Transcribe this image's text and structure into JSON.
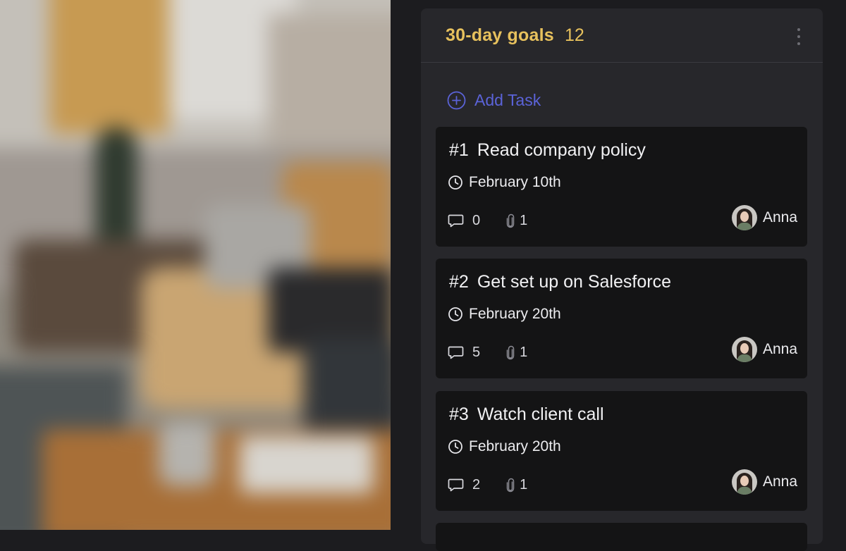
{
  "column": {
    "title": "30-day goals",
    "count": "12",
    "add_task_label": "Add Task"
  },
  "cards": [
    {
      "number": "#1",
      "title": "Read company policy",
      "date": "February 10th",
      "comments": "0",
      "attachments": "1",
      "assignee": "Anna"
    },
    {
      "number": "#2",
      "title": "Get set up on Salesforce",
      "date": "February 20th",
      "comments": "5",
      "attachments": "1",
      "assignee": "Anna"
    },
    {
      "number": "#3",
      "title": "Watch client call",
      "date": "February 20th",
      "comments": "2",
      "attachments": "1",
      "assignee": "Anna"
    }
  ],
  "colors": {
    "accent_title": "#e7c15d",
    "add_task": "#5b63d8",
    "card_bg": "#141415",
    "column_bg": "#27272b"
  },
  "icons": {
    "add": "plus-circle-icon",
    "date": "clock-icon",
    "comments": "comment-icon",
    "attachments": "paperclip-icon",
    "menu": "more-vertical-icon"
  }
}
